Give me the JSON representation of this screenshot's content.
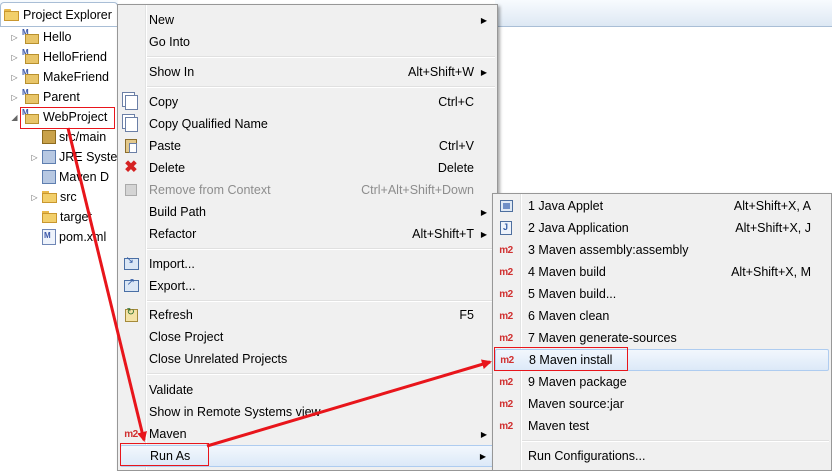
{
  "explorer": {
    "tab_title": "Project Explorer",
    "items": [
      {
        "label": "Hello",
        "type": "project"
      },
      {
        "label": "HelloFriend",
        "type": "project"
      },
      {
        "label": "MakeFriend",
        "type": "project"
      },
      {
        "label": "Parent",
        "type": "project"
      },
      {
        "label": "WebProject",
        "type": "project",
        "expanded": true,
        "selected": true
      },
      {
        "label": "src/main",
        "type": "package-root"
      },
      {
        "label": "JRE Syste",
        "type": "library"
      },
      {
        "label": "Maven D",
        "type": "library"
      },
      {
        "label": "src",
        "type": "folder"
      },
      {
        "label": "target",
        "type": "folder"
      },
      {
        "label": "pom.xml",
        "type": "file"
      }
    ]
  },
  "context_menu": {
    "items": [
      {
        "label": "New",
        "shortcut": "",
        "submenu": true
      },
      {
        "label": "Go Into",
        "shortcut": ""
      },
      {
        "label": "Show In",
        "shortcut": "Alt+Shift+W",
        "submenu": true
      },
      {
        "label": "Copy",
        "shortcut": "Ctrl+C",
        "icon": "copy-icon"
      },
      {
        "label": "Copy Qualified Name",
        "shortcut": "",
        "icon": "copy-icon"
      },
      {
        "label": "Paste",
        "shortcut": "Ctrl+V",
        "icon": "paste-icon"
      },
      {
        "label": "Delete",
        "shortcut": "Delete",
        "icon": "delete-icon"
      },
      {
        "label": "Remove from Context",
        "shortcut": "Ctrl+Alt+Shift+Down",
        "disabled": true,
        "icon": "remove-context-icon"
      },
      {
        "label": "Build Path",
        "shortcut": "",
        "submenu": true
      },
      {
        "label": "Refactor",
        "shortcut": "Alt+Shift+T",
        "submenu": true
      },
      {
        "label": "Import...",
        "shortcut": "",
        "icon": "import-icon"
      },
      {
        "label": "Export...",
        "shortcut": "",
        "icon": "export-icon"
      },
      {
        "label": "Refresh",
        "shortcut": "F5",
        "icon": "refresh-icon"
      },
      {
        "label": "Close Project",
        "shortcut": ""
      },
      {
        "label": "Close Unrelated Projects",
        "shortcut": ""
      },
      {
        "label": "Validate",
        "shortcut": ""
      },
      {
        "label": "Show in Remote Systems view",
        "shortcut": ""
      },
      {
        "label": "Maven",
        "shortcut": "",
        "submenu": true,
        "icon": "m2-icon",
        "icon_text": "m2"
      },
      {
        "label": "Run As",
        "shortcut": "",
        "submenu": true
      }
    ]
  },
  "run_as_submenu": {
    "items": [
      {
        "label": "1 Java Applet",
        "shortcut": "Alt+Shift+X, A",
        "icon": "java-applet-icon"
      },
      {
        "label": "2 Java Application",
        "shortcut": "Alt+Shift+X, J",
        "icon": "java-application-icon"
      },
      {
        "label": "3 Maven assembly:assembly",
        "shortcut": "",
        "icon": "m2-icon",
        "icon_text": "m2"
      },
      {
        "label": "4 Maven build",
        "shortcut": "Alt+Shift+X, M",
        "icon": "m2-icon",
        "icon_text": "m2"
      },
      {
        "label": "5 Maven build...",
        "shortcut": "",
        "icon": "m2-icon",
        "icon_text": "m2"
      },
      {
        "label": "6 Maven clean",
        "shortcut": "",
        "icon": "m2-icon",
        "icon_text": "m2"
      },
      {
        "label": "7 Maven generate-sources",
        "shortcut": "",
        "icon": "m2-icon",
        "icon_text": "m2"
      },
      {
        "label": "8 Maven install",
        "shortcut": "",
        "icon": "m2-icon",
        "icon_text": "m2",
        "highlighted": true
      },
      {
        "label": "9 Maven package",
        "shortcut": "",
        "icon": "m2-icon",
        "icon_text": "m2"
      },
      {
        "label": "Maven source:jar",
        "shortcut": "",
        "icon": "m2-icon",
        "icon_text": "m2"
      },
      {
        "label": "Maven test",
        "shortcut": "",
        "icon": "m2-icon",
        "icon_text": "m2"
      },
      {
        "label": "Run Configurations...",
        "shortcut": ""
      }
    ]
  },
  "colors": {
    "annotation_red": "#e8151b",
    "menu_background": "#f0f0f0",
    "highlight_border": "#aeccf0",
    "m2_icon_red": "#d03030"
  }
}
